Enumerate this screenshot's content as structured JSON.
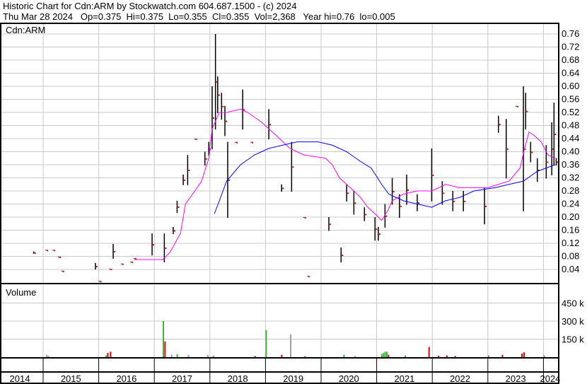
{
  "header": {
    "title": "Historic Chart for Cdn:ARM by Stockwatch.com 604.687.1500 - (c) 2024",
    "quote": "Thu Mar 28 2024   Op=0.375  Hi=0.375  Lo=0.355  Cl=0.355  Vol=2,368   Year hi=0.76  lo=0.005"
  },
  "chart_data": {
    "type": "line",
    "title": "Cdn:ARM",
    "ylim": [
      0,
      0.78
    ],
    "xlim": [
      2014.78,
      2024.27
    ],
    "y_ticks": [
      0.04,
      0.08,
      0.12,
      0.16,
      0.2,
      0.24,
      0.28,
      0.32,
      0.36,
      0.4,
      0.44,
      0.48,
      0.52,
      0.56,
      0.6,
      0.64,
      0.68,
      0.72,
      0.76
    ],
    "x_ticks": [
      "2014",
      "2015",
      "2016",
      "2017",
      "2018",
      "2019",
      "2020",
      "2021",
      "2022",
      "2023",
      "2024"
    ],
    "colors": {
      "bar": "#000000",
      "close": "#e00000",
      "ma_short": "#ff00ff",
      "ma_long": "#0000ff",
      "vol_up": "#3cb43c",
      "vol_down": "#ee0000",
      "vol_flat": "#a0a0a0",
      "grid": "#c8c8c8"
    },
    "price_bars": [
      [
        2014.83,
        0.095,
        0.09
      ],
      [
        2015.05,
        0.1,
        0.1
      ],
      [
        2015.18,
        0.1,
        0.1
      ],
      [
        2015.28,
        0.079,
        0.079
      ],
      [
        2015.34,
        0.036,
        0.036
      ],
      [
        2015.94,
        0.06,
        0.042
      ],
      [
        2016.01,
        0.005,
        0.005
      ],
      [
        2016.2,
        0.042,
        0.042
      ],
      [
        2016.26,
        0.118,
        0.075
      ],
      [
        2016.41,
        0.058,
        0.058
      ],
      [
        2016.58,
        0.064,
        0.064
      ],
      [
        2016.64,
        0.075,
        0.075
      ],
      [
        2016.96,
        0.15,
        0.085
      ],
      [
        2017.18,
        0.15,
        0.064
      ],
      [
        2017.34,
        0.17,
        0.15
      ],
      [
        2017.41,
        0.25,
        0.215
      ],
      [
        2017.52,
        0.33,
        0.3
      ],
      [
        2017.6,
        0.39,
        0.3
      ],
      [
        2017.73,
        0.44,
        0.44
      ],
      [
        2017.91,
        0.4,
        0.36
      ],
      [
        2017.98,
        0.43,
        0.39
      ],
      [
        2018.04,
        0.6,
        0.41
      ],
      [
        2018.1,
        0.76,
        0.47
      ],
      [
        2018.14,
        0.63,
        0.52
      ],
      [
        2018.21,
        0.58,
        0.5
      ],
      [
        2018.27,
        0.54,
        0.45
      ],
      [
        2018.32,
        0.43,
        0.2
      ],
      [
        2018.46,
        0.43,
        0.43
      ],
      [
        2018.59,
        0.59,
        0.47
      ],
      [
        2018.74,
        0.43,
        0.43
      ],
      [
        2019.06,
        0.53,
        0.44
      ],
      [
        2019.29,
        0.3,
        0.28
      ],
      [
        2019.47,
        0.43,
        0.28
      ],
      [
        2019.69,
        0.2,
        0.2
      ],
      [
        2019.76,
        0.02,
        0.02
      ],
      [
        2020.14,
        0.2,
        0.16
      ],
      [
        2020.36,
        0.107,
        0.064
      ],
      [
        2020.46,
        0.3,
        0.25
      ],
      [
        2020.59,
        0.28,
        0.21
      ],
      [
        2020.78,
        0.23,
        0.19
      ],
      [
        2020.97,
        0.2,
        0.13
      ],
      [
        2021.03,
        0.17,
        0.13
      ],
      [
        2021.15,
        0.24,
        0.17
      ],
      [
        2021.28,
        0.32,
        0.24
      ],
      [
        2021.41,
        0.27,
        0.2
      ],
      [
        2021.54,
        0.33,
        0.24
      ],
      [
        2021.73,
        0.27,
        0.22
      ],
      [
        2021.99,
        0.41,
        0.25
      ],
      [
        2022.18,
        0.31,
        0.24
      ],
      [
        2022.37,
        0.28,
        0.22
      ],
      [
        2022.56,
        0.28,
        0.22
      ],
      [
        2022.94,
        0.29,
        0.18
      ],
      [
        2023.19,
        0.51,
        0.46
      ],
      [
        2023.33,
        0.5,
        0.32
      ],
      [
        2023.51,
        0.54,
        0.54
      ],
      [
        2023.64,
        0.6,
        0.22
      ],
      [
        2023.68,
        0.58,
        0.47
      ],
      [
        2023.77,
        0.43,
        0.37
      ],
      [
        2023.89,
        0.38,
        0.31
      ],
      [
        2024.05,
        0.42,
        0.32
      ],
      [
        2024.15,
        0.49,
        0.33
      ],
      [
        2024.19,
        0.55,
        0.36
      ],
      [
        2024.23,
        0.38,
        0.36
      ]
    ],
    "ma_short": [
      [
        2016.64,
        0.07
      ],
      [
        2017.15,
        0.07
      ],
      [
        2017.28,
        0.092
      ],
      [
        2017.47,
        0.15
      ],
      [
        2017.56,
        0.24
      ],
      [
        2017.73,
        0.28
      ],
      [
        2017.85,
        0.31
      ],
      [
        2017.98,
        0.38
      ],
      [
        2018.04,
        0.47
      ],
      [
        2018.17,
        0.52
      ],
      [
        2018.3,
        0.52
      ],
      [
        2018.55,
        0.53
      ],
      [
        2018.68,
        0.52
      ],
      [
        2018.93,
        0.49
      ],
      [
        2019.19,
        0.45
      ],
      [
        2019.44,
        0.41
      ],
      [
        2019.69,
        0.39
      ],
      [
        2020.08,
        0.38
      ],
      [
        2020.2,
        0.36
      ],
      [
        2020.33,
        0.32
      ],
      [
        2020.46,
        0.3
      ],
      [
        2020.59,
        0.28
      ],
      [
        2020.71,
        0.26
      ],
      [
        2020.84,
        0.23
      ],
      [
        2020.97,
        0.21
      ],
      [
        2021.09,
        0.19
      ],
      [
        2021.2,
        0.22
      ],
      [
        2021.28,
        0.25
      ],
      [
        2021.48,
        0.27
      ],
      [
        2021.73,
        0.28
      ],
      [
        2021.99,
        0.28
      ],
      [
        2022.24,
        0.3
      ],
      [
        2022.49,
        0.29
      ],
      [
        2022.75,
        0.29
      ],
      [
        2023.0,
        0.29
      ],
      [
        2023.19,
        0.3
      ],
      [
        2023.38,
        0.31
      ],
      [
        2023.58,
        0.35
      ],
      [
        2023.66,
        0.41
      ],
      [
        2023.74,
        0.46
      ],
      [
        2023.83,
        0.45
      ],
      [
        2023.96,
        0.43
      ],
      [
        2024.08,
        0.39
      ],
      [
        2024.21,
        0.38
      ]
    ],
    "ma_long": [
      [
        2018.08,
        0.21
      ],
      [
        2018.17,
        0.25
      ],
      [
        2018.3,
        0.31
      ],
      [
        2018.55,
        0.36
      ],
      [
        2018.8,
        0.39
      ],
      [
        2019.06,
        0.41
      ],
      [
        2019.31,
        0.42
      ],
      [
        2019.57,
        0.43
      ],
      [
        2019.95,
        0.43
      ],
      [
        2020.2,
        0.42
      ],
      [
        2020.46,
        0.4
      ],
      [
        2020.71,
        0.37
      ],
      [
        2020.9,
        0.35
      ],
      [
        2021.09,
        0.3
      ],
      [
        2021.22,
        0.27
      ],
      [
        2021.48,
        0.25
      ],
      [
        2021.73,
        0.24
      ],
      [
        2021.99,
        0.23
      ],
      [
        2022.24,
        0.25
      ],
      [
        2022.49,
        0.26
      ],
      [
        2022.75,
        0.28
      ],
      [
        2023.13,
        0.29
      ],
      [
        2023.38,
        0.3
      ],
      [
        2023.64,
        0.31
      ],
      [
        2023.89,
        0.34
      ],
      [
        2024.21,
        0.36
      ]
    ],
    "volume": {
      "label": "Volume",
      "ticks": [
        "150 k",
        "300 k",
        "450 k"
      ],
      "tick_values": [
        150,
        300,
        450
      ],
      "bars": [
        [
          2015.05,
          20,
          "flat"
        ],
        [
          2015.08,
          12,
          "flat"
        ],
        [
          2016.15,
          35,
          "down"
        ],
        [
          2016.2,
          45,
          "down"
        ],
        [
          2016.12,
          15,
          "up"
        ],
        [
          2017.15,
          300,
          "up"
        ],
        [
          2017.18,
          130,
          "down"
        ],
        [
          2017.3,
          20,
          "flat"
        ],
        [
          2017.4,
          25,
          "up"
        ],
        [
          2017.6,
          20,
          "flat"
        ],
        [
          2017.95,
          18,
          "flat"
        ],
        [
          2018.05,
          12,
          "up"
        ],
        [
          2018.8,
          10,
          "down"
        ],
        [
          2019.0,
          225,
          "up"
        ],
        [
          2019.28,
          20,
          "down"
        ],
        [
          2019.44,
          190,
          "flat"
        ],
        [
          2019.7,
          8,
          "down"
        ],
        [
          2020.4,
          20,
          "up"
        ],
        [
          2020.6,
          10,
          "flat"
        ],
        [
          2021.08,
          25,
          "up"
        ],
        [
          2021.11,
          35,
          "up"
        ],
        [
          2021.14,
          45,
          "up"
        ],
        [
          2021.17,
          45,
          "up"
        ],
        [
          2021.2,
          20,
          "down"
        ],
        [
          2021.5,
          15,
          "up"
        ],
        [
          2021.93,
          85,
          "down"
        ],
        [
          2022.1,
          12,
          "down"
        ],
        [
          2022.25,
          15,
          "down"
        ],
        [
          2022.4,
          10,
          "down"
        ],
        [
          2023.0,
          15,
          "up"
        ],
        [
          2023.25,
          20,
          "down"
        ],
        [
          2023.6,
          30,
          "down"
        ],
        [
          2023.64,
          40,
          "down"
        ],
        [
          2024.0,
          15,
          "up"
        ]
      ]
    }
  }
}
